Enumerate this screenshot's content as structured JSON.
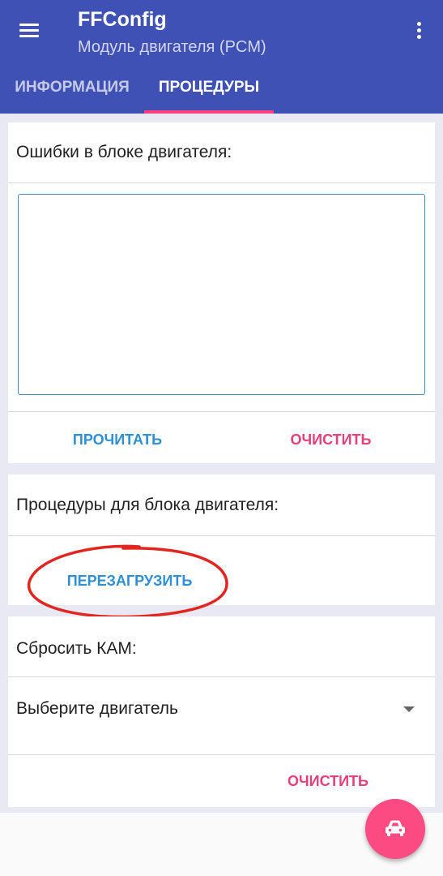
{
  "appbar": {
    "title": "FFConfig",
    "subtitle": "Модуль двигателя (PCM)",
    "menu_icon": "hamburger-menu-icon",
    "more_icon": "more-vert-icon"
  },
  "tabs": [
    {
      "label": "ИНФОРМАЦИЯ",
      "selected": false
    },
    {
      "label": "ПРОЦЕДУРЫ",
      "selected": true
    }
  ],
  "errors_card": {
    "title": "Ошибки в блоке двигателя:",
    "text_value": "",
    "read_label": "ПРОЧИТАТЬ",
    "clear_label": "ОЧИСТИТЬ"
  },
  "procedures_card": {
    "title": "Процедуры для блока двигателя:",
    "reboot_label": "ПЕРЕЗАГРУЗИТЬ"
  },
  "kam_card": {
    "title": "Сбросить КАМ:",
    "engine_select_value": "Выберите двигатель",
    "clear_label": "ОЧИСТИТЬ"
  },
  "fab": {
    "icon": "car-icon"
  },
  "colors": {
    "primary": "#3f51b5",
    "accent": "#ff4081",
    "button_blue": "#2e8fd4",
    "button_pink": "#e4407b",
    "fab": "#fc4a82",
    "annotation": "#e0261e"
  }
}
